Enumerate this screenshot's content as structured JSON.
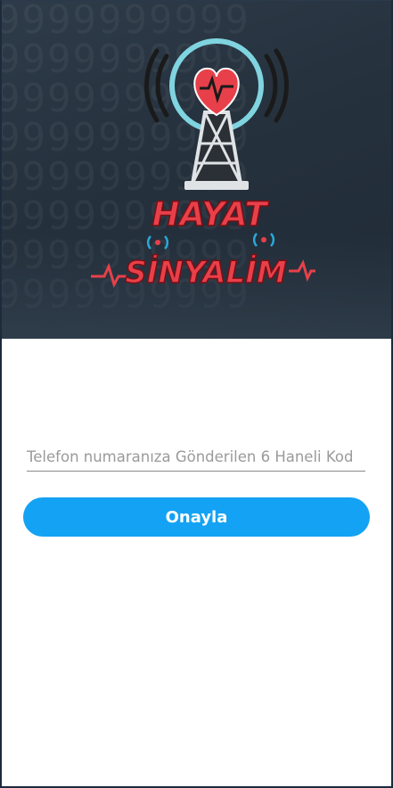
{
  "hero": {
    "logo": {
      "line1": "HAYAT",
      "line2": "SİNYALİM"
    }
  },
  "verification": {
    "code_placeholder": "Telefon numaranıza Gönderilen 6 Haneli Kod",
    "code_value": "",
    "confirm_label": "Onayla"
  },
  "colors": {
    "accent": "#14a2f4",
    "logo_red": "#e8404a",
    "hero_bg": "#2a3643"
  },
  "icons": [
    "radio-tower-icon",
    "heart-pulse-icon",
    "signal-waves-icon"
  ]
}
